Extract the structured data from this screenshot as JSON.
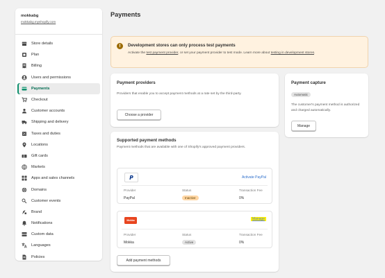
{
  "store": {
    "name": "mokkabg",
    "url": "mokkabg.myshopify.com"
  },
  "sidebar": {
    "items": [
      {
        "label": "Store details",
        "icon": "store-icon"
      },
      {
        "label": "Plan",
        "icon": "plan-icon"
      },
      {
        "label": "Billing",
        "icon": "billing-icon"
      },
      {
        "label": "Users and permissions",
        "icon": "users-icon"
      },
      {
        "label": "Payments",
        "icon": "payments-icon",
        "active": true
      },
      {
        "label": "Checkout",
        "icon": "cart-icon"
      },
      {
        "label": "Customer accounts",
        "icon": "customer-icon"
      },
      {
        "label": "Shipping and delivery",
        "icon": "truck-icon"
      },
      {
        "label": "Taxes and duties",
        "icon": "tax-icon"
      },
      {
        "label": "Locations",
        "icon": "location-pin-icon"
      },
      {
        "label": "Gift cards",
        "icon": "gift-card-icon"
      },
      {
        "label": "Markets",
        "icon": "globe-icon"
      },
      {
        "label": "Apps and sales channels",
        "icon": "apps-icon"
      },
      {
        "label": "Domains",
        "icon": "domain-globe-icon"
      },
      {
        "label": "Customer events",
        "icon": "customer-events-icon"
      },
      {
        "label": "Brand",
        "icon": "brand-icon"
      },
      {
        "label": "Notifications",
        "icon": "bell-icon"
      },
      {
        "label": "Custom data",
        "icon": "custom-data-icon"
      },
      {
        "label": "Languages",
        "icon": "languages-icon"
      },
      {
        "label": "Policies",
        "icon": "policies-icon"
      }
    ]
  },
  "page": {
    "title": "Payments"
  },
  "banner": {
    "title": "Development stores can only process test payments",
    "text_1": "Activate the ",
    "link_1": "test payment provider",
    "text_2": ", or set your payment provider to test mode. Learn more about ",
    "link_2": "testing in development stores",
    "text_3": "."
  },
  "providers": {
    "title": "Payment providers",
    "description": "Providers that enable you to accept payment methods at a rate set by the third-party.",
    "button": "Choose a provider"
  },
  "supported": {
    "title": "Supported payment methods",
    "description": "Payment methods that are available with one of Shopify's approved payment providers.",
    "col_provider": "Provider",
    "col_status": "Status",
    "col_fee": "Transaction Fee",
    "paypal": {
      "logo_text": "P",
      "action": "Activate PayPal",
      "name": "PayPal",
      "status": "Inactive",
      "fee": "0%"
    },
    "mokka": {
      "logo_text": "Mokka",
      "action": "Manage",
      "name": "Mokka",
      "status": "Active",
      "fee": "0%"
    },
    "add_button": "Add payment methods"
  },
  "capture": {
    "title": "Payment capture",
    "badge": "Automatic",
    "description": "The customer's payment method is authorized and charged automatically.",
    "button": "Manage"
  },
  "colors": {
    "accent": "#0c8f6b",
    "link": "#2c6ecb",
    "banner_bg": "#fff2e0",
    "mokka_red": "#e8451f",
    "paypal_blue": "#003087",
    "highlight": "#fff200"
  }
}
